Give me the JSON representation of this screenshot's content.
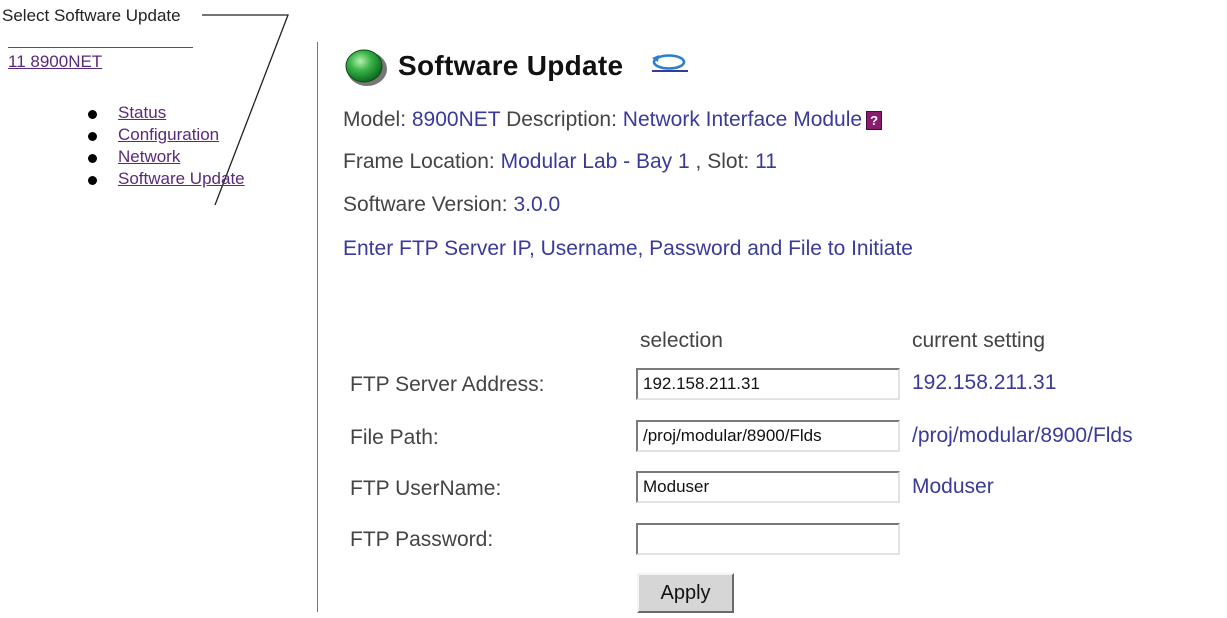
{
  "callout": {
    "text": "Select Software Update"
  },
  "sidebar": {
    "module_link": "11 8900NET",
    "items": [
      {
        "label": "Status"
      },
      {
        "label": "Configuration"
      },
      {
        "label": "Network"
      },
      {
        "label": "Software Update"
      }
    ]
  },
  "header": {
    "title": "Software Update"
  },
  "info": {
    "model_label": "Model:",
    "model_value": "8900NET",
    "description_label": "Description:",
    "description_value": "Network Interface Module",
    "help_glyph": "?",
    "frame_location_label": "Frame Location:",
    "frame_location_value": "Modular Lab - Bay 1",
    "slot_label": ", Slot:",
    "slot_value": "11",
    "software_version_label": "Software Version:",
    "software_version_value": "3.0.0"
  },
  "prompt": "Enter FTP Server IP, Username, Password and File to Initiate",
  "form": {
    "col_selection": "selection",
    "col_current": "current setting",
    "rows": [
      {
        "label": "FTP Server Address:",
        "value": "192.158.211.31",
        "current": "192.158.211.31"
      },
      {
        "label": "File Path:",
        "value": "/proj/modular/8900/Flds",
        "current": "/proj/modular/8900/Flds"
      },
      {
        "label": "FTP UserName:",
        "value": "Moduser",
        "current": "Moduser"
      },
      {
        "label": "FTP Password:",
        "value": "",
        "current": ""
      }
    ],
    "apply_label": "Apply"
  },
  "colors": {
    "link": "#5a2a7a",
    "value": "#3a3a9a",
    "led": "#2fa84a"
  },
  "icons": {
    "status": "green-led-icon",
    "refresh": "refresh-icon",
    "help": "help-icon"
  }
}
